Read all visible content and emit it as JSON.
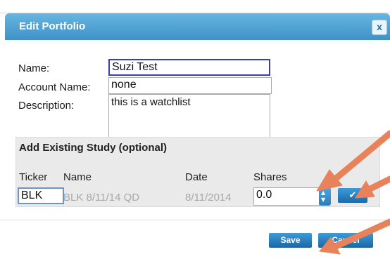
{
  "dialog": {
    "title": "Edit Portfolio",
    "close_label": "x"
  },
  "form": {
    "name_label": "Name:",
    "name_value": "Suzi Test",
    "account_label": "Account Name:",
    "account_value": "none",
    "description_label": "Description:",
    "description_value": "this is a watchlist"
  },
  "study": {
    "section_title": "Add Existing Study (optional)",
    "columns": [
      "Ticker",
      "Name",
      "Date",
      "Shares"
    ],
    "ticker_value": "BLK",
    "name_value": "BLK 8/11/14 QD",
    "date_value": "8/11/2014",
    "shares_value": "0.0",
    "add_icon": "check-icon"
  },
  "buttons": {
    "save_label": "Save",
    "cancel_label": "Cancel"
  },
  "colors": {
    "titlebar": "#4a9fd4",
    "button": "#2a7dbf",
    "arrow": "#e8825a",
    "focus_border": "#3a3dbb"
  }
}
